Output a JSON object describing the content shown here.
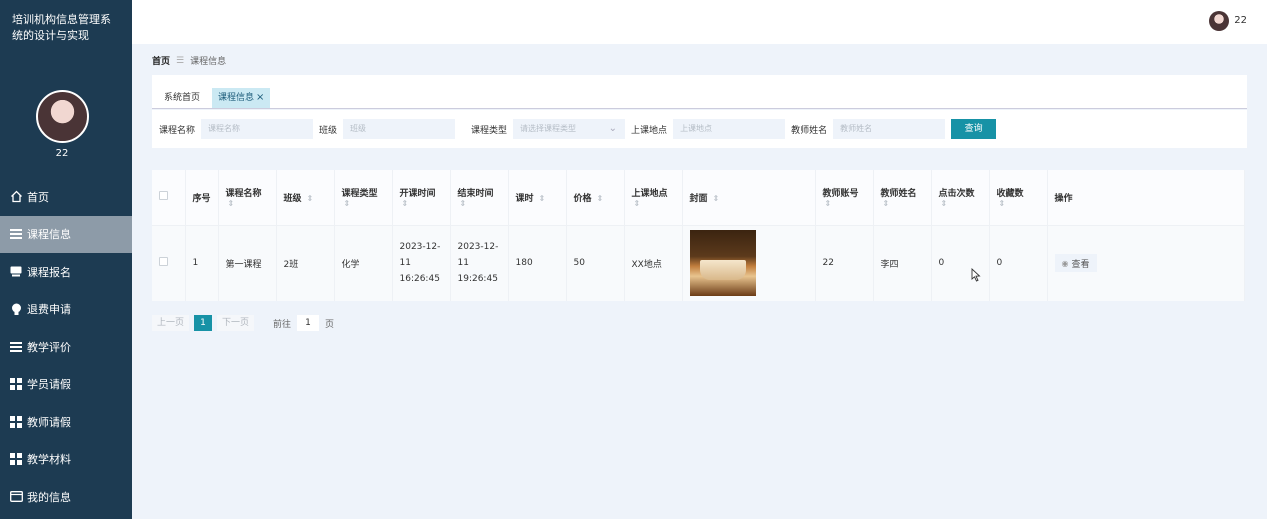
{
  "sidebar": {
    "title": "培训机构信息管理系统的设计与实现",
    "user_name": "22",
    "items": [
      {
        "label": "首页",
        "icon": "home-icon"
      },
      {
        "label": "课程信息",
        "icon": "list-icon"
      },
      {
        "label": "课程报名",
        "icon": "card-icon"
      },
      {
        "label": "退费申请",
        "icon": "bulb-icon"
      },
      {
        "label": "教学评价",
        "icon": "list-icon"
      },
      {
        "label": "学员请假",
        "icon": "grid-icon"
      },
      {
        "label": "教师请假",
        "icon": "grid-icon"
      },
      {
        "label": "教学材料",
        "icon": "grid-icon"
      },
      {
        "label": "我的信息",
        "icon": "window-icon"
      }
    ],
    "active_index": 1
  },
  "topbar": {
    "user_name": "22"
  },
  "breadcrumb": {
    "home": "首页",
    "separator": "☰",
    "current": "课程信息"
  },
  "tabs": [
    {
      "label": "系统首页"
    },
    {
      "label": "课程信息",
      "close": "×"
    }
  ],
  "search": {
    "course_name_label": "课程名称",
    "course_name_placeholder": "课程名称",
    "class_label": "班级",
    "class_placeholder": "班级",
    "type_label": "课程类型",
    "type_placeholder": "请选择课程类型",
    "location_label": "上课地点",
    "location_placeholder": "上课地点",
    "teacher_label": "教师姓名",
    "teacher_placeholder": "教师姓名",
    "query_button": "查询"
  },
  "table": {
    "headers": [
      "序号",
      "课程名称",
      "班级",
      "课程类型",
      "开课时间",
      "结束时间",
      "课时",
      "价格",
      "上课地点",
      "封面",
      "教师账号",
      "教师姓名",
      "点击次数",
      "收藏数",
      "操作"
    ],
    "sort_glyph": "⇕",
    "rows": [
      {
        "index": "1",
        "name": "第一课程",
        "class": "2班",
        "type": "化学",
        "start": "2023-12-11 16:26:45",
        "end": "2023-12-11 19:26:45",
        "hours": "180",
        "price": "50",
        "location": "XX地点",
        "teacher_account": "22",
        "teacher_name": "李四",
        "clicks": "0",
        "favorites": "0",
        "action": "查看"
      }
    ]
  },
  "pager": {
    "prev": "上一页",
    "current": "1",
    "next": "下一页",
    "goto": "前往",
    "page_input": "1",
    "page_unit": "页"
  },
  "colors": {
    "sidebar_bg": "#1d3b52",
    "accent": "#1792a6",
    "active_menu": "#8d9ba8"
  }
}
